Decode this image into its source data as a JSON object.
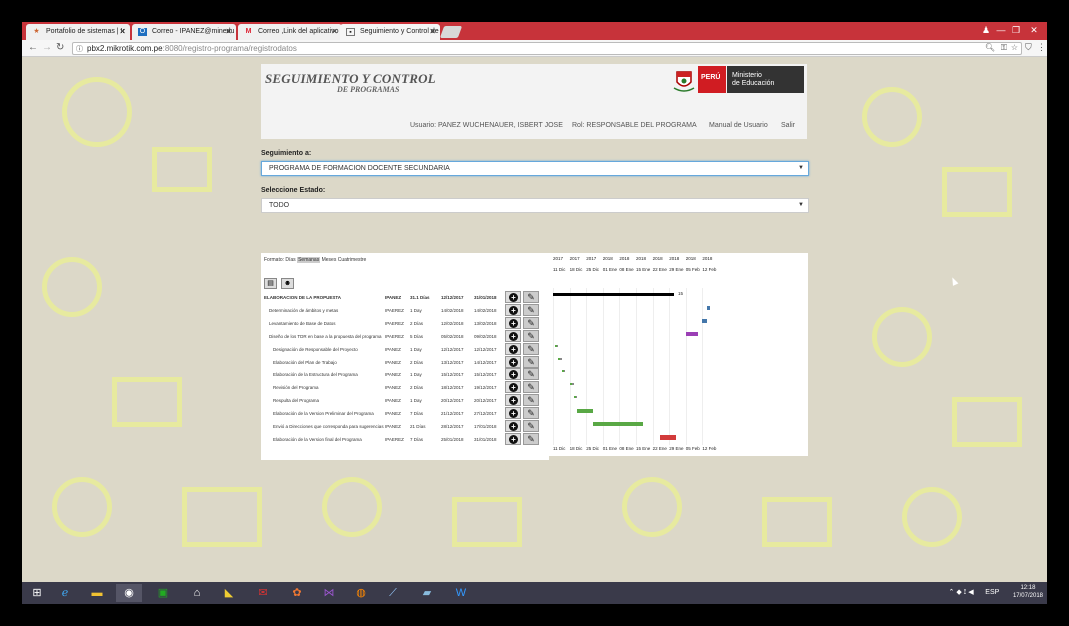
{
  "browser": {
    "tabs": [
      {
        "label": "Portafolio de sistemas | Ir",
        "icon": "app-icon"
      },
      {
        "label": "Correo - IPANEZ@minedu",
        "icon": "outlook-icon"
      },
      {
        "label": "Correo ,Link del aplicativo",
        "icon": "gmail-icon"
      },
      {
        "label": "Seguimiento y Control de",
        "icon": "page-icon"
      }
    ],
    "url_host": "pbx2.mikrotik.com.pe",
    "url_path": ":8080/registro-programa/registrodatos"
  },
  "header": {
    "title_line1": "SEGUIMIENTO Y CONTROL",
    "title_line2": "DE PROGRAMAS",
    "peru_label": "PERÚ",
    "ministry_line1": "Ministerio",
    "ministry_line2": "de Educación",
    "user": "Usuario: PANEZ WUCHENAUER, ISBERT JOSE",
    "role": "Rol: RESPONSABLE DEL PROGRAMA",
    "manual": "Manual de Usuario",
    "logout": "Salir"
  },
  "form": {
    "seguimiento_label": "Seguimiento a:",
    "seguimiento_value": "PROGRAMA DE FORMACION DOCENTE SECUNDARIA",
    "estado_label": "Seleccione Estado:",
    "estado_value": "TODO"
  },
  "gantt": {
    "formats_label": "Formato:",
    "formats": [
      "Días",
      "Semanas",
      "Meses",
      "Cuatrimestre"
    ],
    "selected_format": "Semanas",
    "years": [
      "2017",
      "2017",
      "2017",
      "2018",
      "2018",
      "2018",
      "2018",
      "2018",
      "2018",
      "2018"
    ],
    "weeks": [
      "11 Dic",
      "18 Dic",
      "25 Dic",
      "01 Ene",
      "08 Ene",
      "15 Ene",
      "22 Ene",
      "29 Ene",
      "05 Feb",
      "12 Feb"
    ],
    "rows": [
      {
        "name": "ELABORACION DE LA PROPUESTA",
        "resp": "IPANEZ",
        "dur": "31.1 Días",
        "start": "12/12/2017",
        "end": "31/01/2018",
        "bold": true
      },
      {
        "name": "Determinación de ámbitos y metas",
        "resp": "IPAEREZ",
        "dur": "1 Day",
        "start": "14/02/2018",
        "end": "14/02/2018"
      },
      {
        "name": "Levantamiento de Base de Datos",
        "resp": "IPAEREZ",
        "dur": "2 Días",
        "start": "12/02/2018",
        "end": "13/02/2018"
      },
      {
        "name": "Diseño de los TDR en base a la propuesta del programa",
        "resp": "IPAEREZ",
        "dur": "5 Días",
        "start": "05/02/2018",
        "end": "09/02/2018"
      },
      {
        "name": "Designación de Responsable del Proyecto",
        "resp": "IPANEZ",
        "dur": "1 Day",
        "start": "12/12/2017",
        "end": "12/12/2017"
      },
      {
        "name": "Elaboración del Plan de Trabajo",
        "resp": "IPANEZ",
        "dur": "2 Días",
        "start": "13/12/2017",
        "end": "14/12/2017"
      },
      {
        "name": "Elaboración de la Estructura del Programa",
        "resp": "IPANEZ",
        "dur": "1 Day",
        "start": "15/12/2017",
        "end": "15/12/2017"
      },
      {
        "name": "Revisión del Programa",
        "resp": "IPANEZ",
        "dur": "2 Días",
        "start": "18/12/2017",
        "end": "19/12/2017"
      },
      {
        "name": "Respulta del Programa",
        "resp": "IPANEZ",
        "dur": "1 Day",
        "start": "20/12/2017",
        "end": "20/12/2017"
      },
      {
        "name": "Elaboración de la Version Preliminar del Programa",
        "resp": "IPANEZ",
        "dur": "7 Días",
        "start": "21/12/2017",
        "end": "27/12/2017"
      },
      {
        "name": "Envió a Direcciones que corresponda para sugerencias",
        "resp": "IPANEZ",
        "dur": "21 Días",
        "start": "28/12/2017",
        "end": "17/01/2018"
      },
      {
        "name": "Elaboración de la Version final del Programa",
        "resp": "IPAEREZ",
        "dur": "7 Días",
        "start": "25/01/2018",
        "end": "31/01/2018"
      }
    ],
    "summary_label": "15"
  },
  "taskbar": {
    "time": "12:18",
    "date": "17/07/2018",
    "lang": "ESP"
  },
  "colors": {
    "tabstrip": "#c7333a",
    "peru_red": "#d01c22",
    "gantt_green": "#59a845",
    "gantt_purple": "#9b3fb5",
    "gantt_red": "#d23b3b",
    "gantt_gray": "#888888"
  }
}
